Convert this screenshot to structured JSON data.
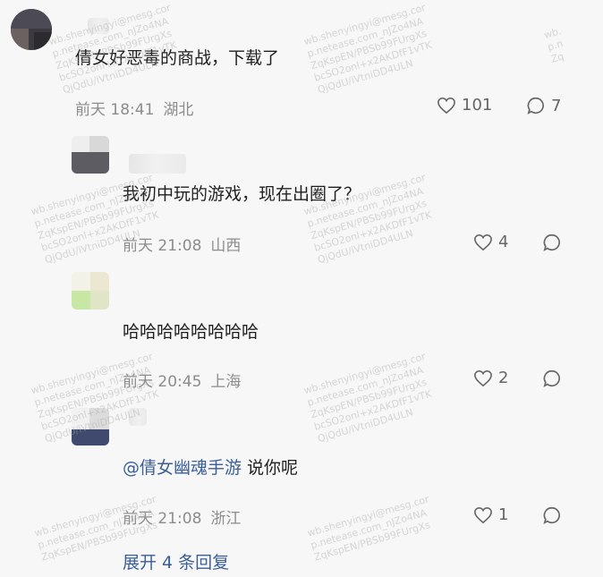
{
  "comments": [
    {
      "text": "倩女好恶毒的商战，下载了",
      "date": "前天 18:41",
      "location": "湖北",
      "likes": "101",
      "replies": "7"
    },
    {
      "text": "我初中玩的游戏，现在出圈了？",
      "date": "前天 21:08",
      "location": "山西",
      "likes": "4",
      "replies": ""
    },
    {
      "text": "哈哈哈哈哈哈哈哈",
      "date": "前天 20:45",
      "location": "上海",
      "likes": "2",
      "replies": ""
    },
    {
      "mention": "@倩女幽魂手游",
      "text": " 说你呢",
      "date": "前天 21:08",
      "location": "浙江",
      "likes": "1",
      "replies": ""
    }
  ],
  "expand_label": "展开 4 条回复",
  "watermark": [
    "wb.shenyingyi@mesg.cor",
    "p.netease.com_nJZo4NA",
    "ZqKspEN/PBSb99FUrgXs",
    "bcSO2onl+x2AKDfF1vTK",
    "QjQdU/iVtniDD4ULN"
  ],
  "colors": {
    "link": "#3a5e98",
    "meta": "#8c8c8c",
    "background": "#f7f7f7"
  }
}
